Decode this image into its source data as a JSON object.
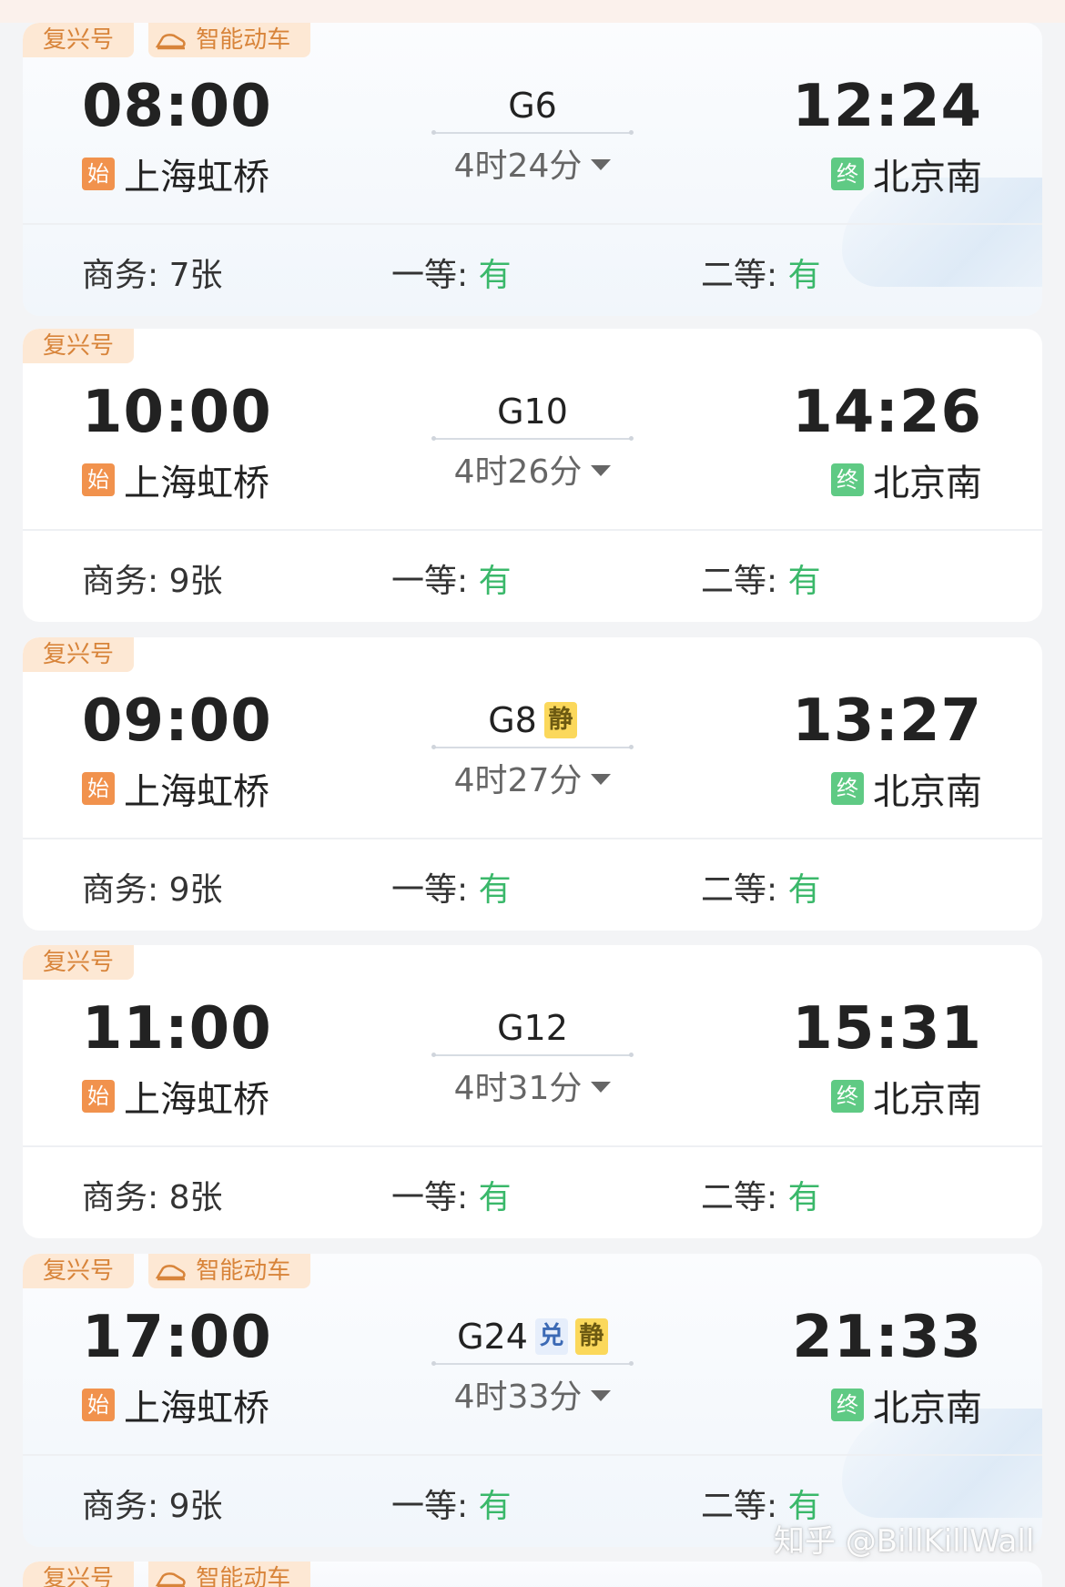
{
  "labels": {
    "seat_business": "商务: ",
    "seat_first": "一等: ",
    "seat_second": "二等: ",
    "badge_start": "始",
    "badge_end": "终",
    "badge_jing": "静",
    "badge_dui": "兑",
    "tag_fuxing": "复兴号",
    "tag_smart": "智能动车"
  },
  "trains": [
    {
      "dep_time": "08:00",
      "arr_time": "12:24",
      "train_no": "G6",
      "duration": "4时24分",
      "dep_station": "上海虹桥",
      "arr_station": "北京南",
      "business": "7张",
      "first": "有",
      "second": "有"
    },
    {
      "dep_time": "10:00",
      "arr_time": "14:26",
      "train_no": "G10",
      "duration": "4时26分",
      "dep_station": "上海虹桥",
      "arr_station": "北京南",
      "business": "9张",
      "first": "有",
      "second": "有"
    },
    {
      "dep_time": "09:00",
      "arr_time": "13:27",
      "train_no": "G8",
      "duration": "4时27分",
      "dep_station": "上海虹桥",
      "arr_station": "北京南",
      "business": "9张",
      "first": "有",
      "second": "有"
    },
    {
      "dep_time": "11:00",
      "arr_time": "15:31",
      "train_no": "G12",
      "duration": "4时31分",
      "dep_station": "上海虹桥",
      "arr_station": "北京南",
      "business": "8张",
      "first": "有",
      "second": "有"
    },
    {
      "dep_time": "17:00",
      "arr_time": "21:33",
      "train_no": "G24",
      "duration": "4时33分",
      "dep_station": "上海虹桥",
      "arr_station": "北京南",
      "business": "9张",
      "first": "有",
      "second": "有"
    }
  ],
  "watermark": "知乎 @BillKillWall",
  "colors": {
    "tag_bg": "#fde8d4",
    "tag_text": "#d8843a",
    "start_badge": "#f1924d",
    "end_badge": "#5fca84",
    "available": "#3ab86a",
    "jing_bg": "#fbd85b",
    "dui_bg": "#e6eefb"
  },
  "icons": [
    "smart-train-icon",
    "chevron-down-icon"
  ]
}
